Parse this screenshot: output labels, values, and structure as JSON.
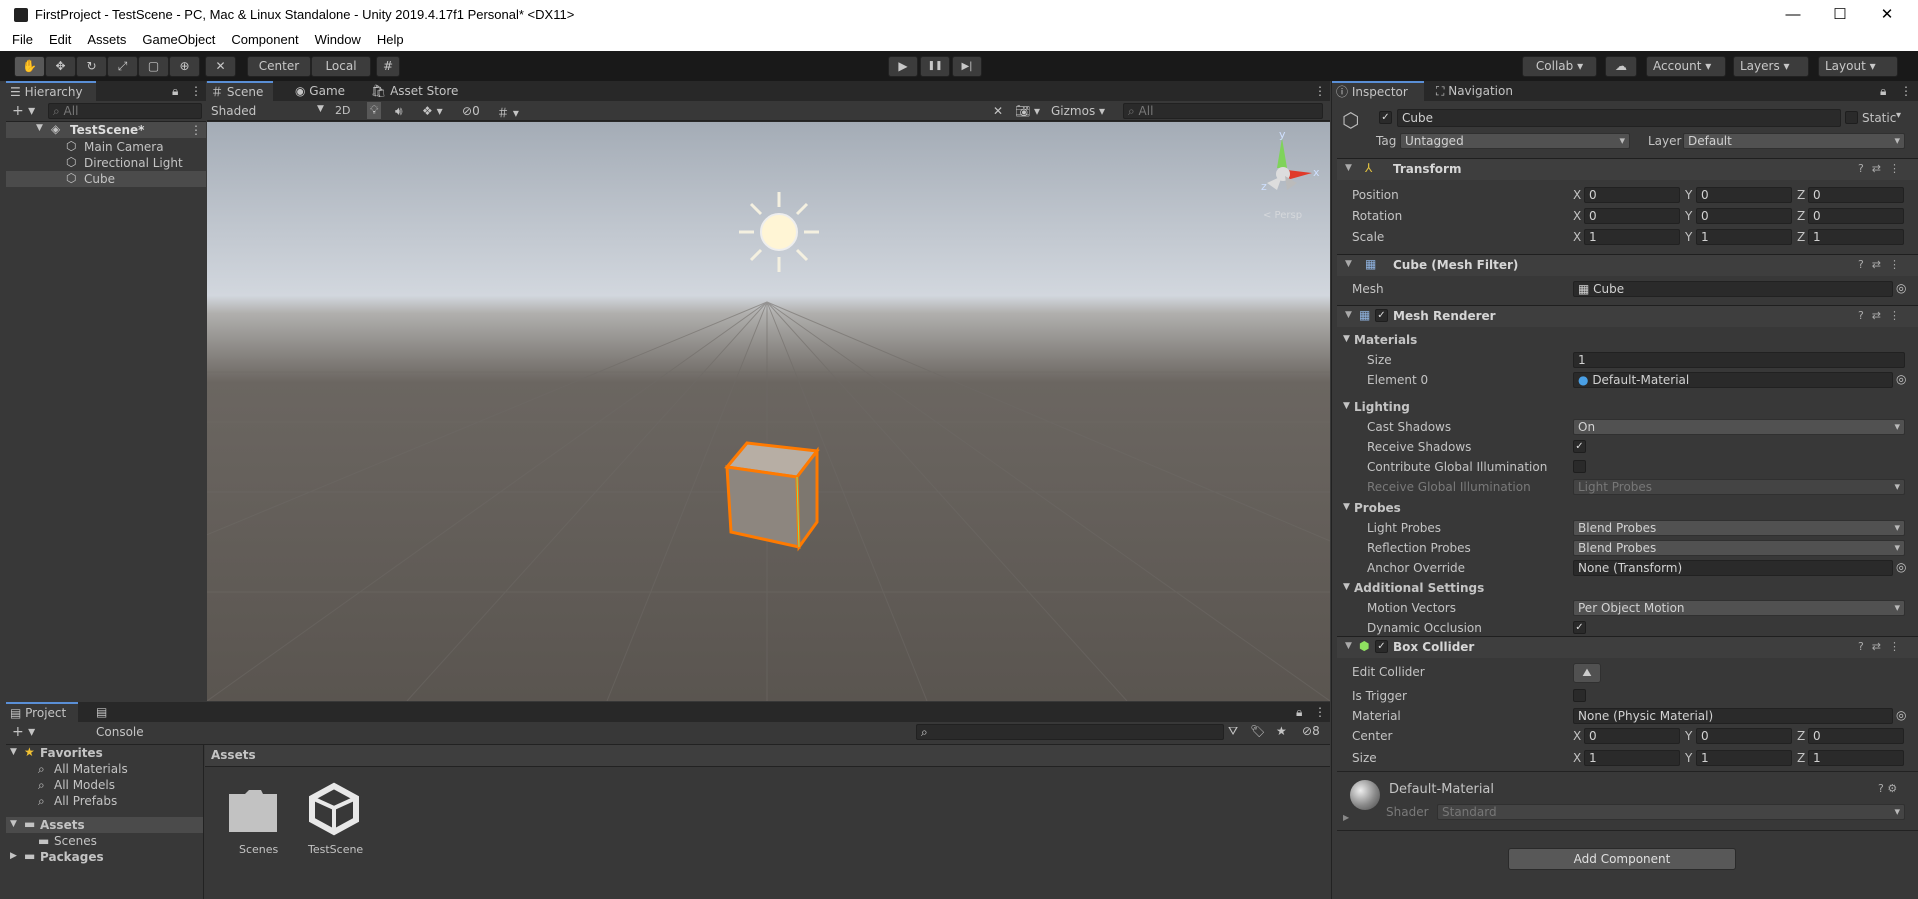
{
  "window": {
    "title": "FirstProject - TestScene - PC, Mac & Linux Standalone - Unity 2019.4.17f1 Personal* <DX11>",
    "minimize": "—",
    "maximize": "☐",
    "close": "✕"
  },
  "menu": [
    "File",
    "Edit",
    "Assets",
    "GameObject",
    "Component",
    "Window",
    "Help"
  ],
  "toolbar": {
    "center": "Center",
    "local": "Local",
    "play": "▶",
    "pause": "❚❚",
    "step": "▶|",
    "collab": "Collab ▾",
    "account": "Account",
    "layers": "Layers",
    "layout": "Layout"
  },
  "hierarchy": {
    "tab": "Hierarchy",
    "search_placeholder": "All",
    "scene": "TestScene*",
    "items": [
      "Main Camera",
      "Directional Light",
      "Cube"
    ]
  },
  "scene_tabs": {
    "scene": "Scene",
    "game": "Game",
    "store": "Asset Store"
  },
  "scene_toolbar": {
    "shading": "Shaded",
    "mode2d": "2D",
    "hidden_count": "0",
    "gizmos": "Gizmos",
    "search_placeholder": "All"
  },
  "gizmo": {
    "y": "y",
    "x": "x",
    "z": "z",
    "persp": "< Persp"
  },
  "project": {
    "tab_project": "Project",
    "tab_console": "Console",
    "favorites": "Favorites",
    "fav_items": [
      "All Materials",
      "All Models",
      "All Prefabs"
    ],
    "assets": "Assets",
    "asset_children": [
      "Scenes"
    ],
    "packages": "Packages",
    "breadcrumb": "Assets",
    "files": [
      "Scenes",
      "TestScene"
    ],
    "hidden_count": "8"
  },
  "inspector": {
    "tab_inspector": "Inspector",
    "tab_navigation": "Navigation",
    "object_name": "Cube",
    "static_label": "Static",
    "tag_label": "Tag",
    "tag_value": "Untagged",
    "layer_label": "Layer",
    "layer_value": "Default",
    "transform": {
      "title": "Transform",
      "rows": [
        {
          "label": "Position",
          "x": "0",
          "y": "0",
          "z": "0"
        },
        {
          "label": "Rotation",
          "x": "0",
          "y": "0",
          "z": "0"
        },
        {
          "label": "Scale",
          "x": "1",
          "y": "1",
          "z": "1"
        }
      ]
    },
    "mesh_filter": {
      "title": "Cube (Mesh Filter)",
      "mesh_label": "Mesh",
      "mesh_value": "Cube"
    },
    "mesh_renderer": {
      "title": "Mesh Renderer",
      "materials": "Materials",
      "size_label": "Size",
      "size_value": "1",
      "element0_label": "Element 0",
      "element0_value": "Default-Material",
      "lighting": "Lighting",
      "cast_shadows_label": "Cast Shadows",
      "cast_shadows_value": "On",
      "receive_shadows_label": "Receive Shadows",
      "contribute_gi_label": "Contribute Global Illumination",
      "receive_gi_label": "Receive Global Illumination",
      "receive_gi_value": "Light Probes",
      "probes": "Probes",
      "light_probes_label": "Light Probes",
      "light_probes_value": "Blend Probes",
      "reflection_probes_label": "Reflection Probes",
      "reflection_probes_value": "Blend Probes",
      "anchor_label": "Anchor Override",
      "anchor_value": "None (Transform)",
      "additional": "Additional Settings",
      "motion_label": "Motion Vectors",
      "motion_value": "Per Object Motion",
      "dynamic_occlusion_label": "Dynamic Occlusion"
    },
    "box_collider": {
      "title": "Box Collider",
      "edit_label": "Edit Collider",
      "trigger_label": "Is Trigger",
      "material_label": "Material",
      "material_value": "None (Physic Material)",
      "center_label": "Center",
      "cx": "0",
      "cy": "0",
      "cz": "0",
      "size_label": "Size",
      "sx": "1",
      "sy": "1",
      "sz": "1"
    },
    "material": {
      "name": "Default-Material",
      "shader_label": "Shader",
      "shader_value": "Standard"
    },
    "add_component": "Add Component",
    "axis_x": "X",
    "axis_y": "Y",
    "axis_z": "Z"
  },
  "colors": {
    "accent": "#5a8fd6",
    "selection": "#ff7a00",
    "scene_sky": "#c5ccd6",
    "scene_ground": "#5f5a55"
  }
}
